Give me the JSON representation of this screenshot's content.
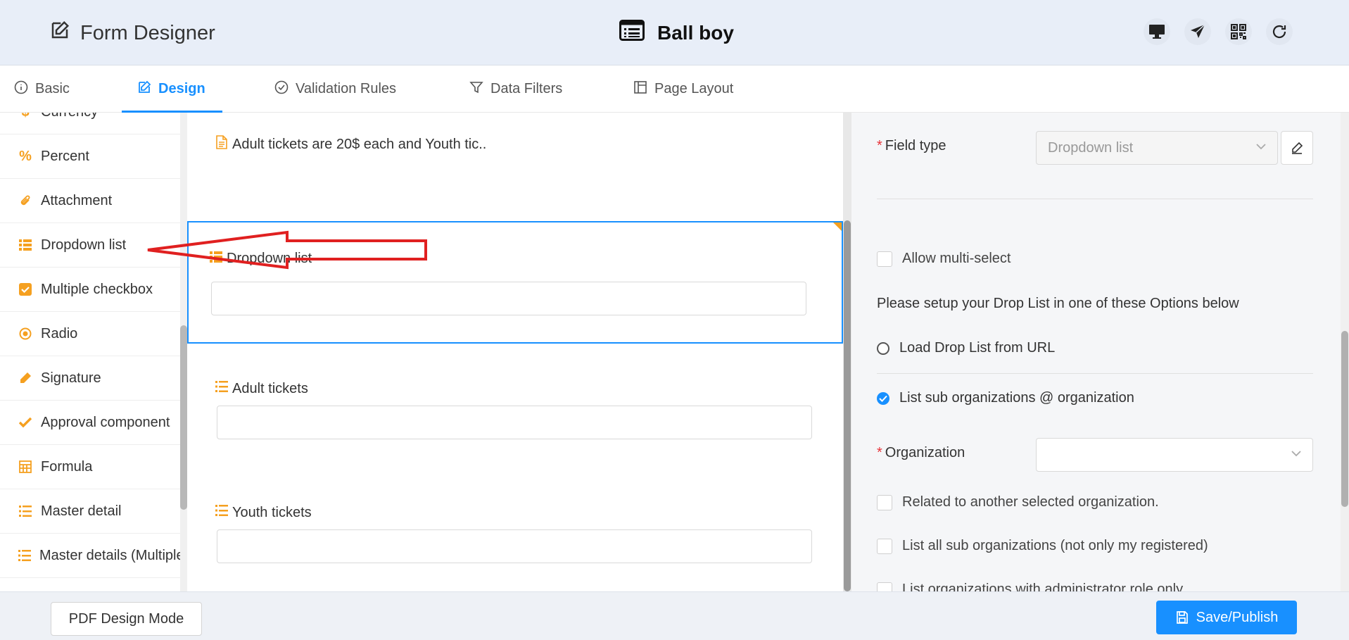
{
  "header": {
    "app_title": "Form Designer",
    "doc_title": "Ball boy",
    "icons": [
      "desktop-icon",
      "send-icon",
      "qrcode-icon",
      "reload-icon"
    ]
  },
  "tabs": [
    {
      "label": "Basic",
      "icon": "info-icon"
    },
    {
      "label": "Design",
      "icon": "edit-icon",
      "active": true
    },
    {
      "label": "Validation Rules",
      "icon": "check-circle-icon"
    },
    {
      "label": "Data Filters",
      "icon": "filter-icon"
    },
    {
      "label": "Page Layout",
      "icon": "layout-icon"
    }
  ],
  "palette": {
    "items": [
      {
        "label": "Currency",
        "icon": "dollar-icon"
      },
      {
        "label": "Percent",
        "icon": "percent-icon"
      },
      {
        "label": "Attachment",
        "icon": "paperclip-icon"
      },
      {
        "label": "Dropdown list",
        "icon": "list-icon"
      },
      {
        "label": "Multiple checkbox",
        "icon": "checkbox-icon"
      },
      {
        "label": "Radio",
        "icon": "radio-icon"
      },
      {
        "label": "Signature",
        "icon": "pencil-icon"
      },
      {
        "label": "Approval component",
        "icon": "checkmark-icon"
      },
      {
        "label": "Formula",
        "icon": "calculator-icon"
      },
      {
        "label": "Master detail",
        "icon": "ordered-list-icon"
      },
      {
        "label": "Master details (Multiple)",
        "icon": "ordered-list-icon"
      }
    ]
  },
  "canvas": {
    "note": "Adult tickets are 20$ each and Youth tic..",
    "fields": [
      {
        "label": "Dropdown list",
        "icon": "list-icon",
        "selected": true
      },
      {
        "label": "Adult tickets",
        "icon": "ordered-list-icon"
      },
      {
        "label": "Youth tickets",
        "icon": "ordered-list-icon"
      }
    ]
  },
  "properties": {
    "field_type_label": "Field type",
    "field_type_value": "Dropdown list",
    "allow_multi_select": "Allow multi-select",
    "setup_text": "Please setup your Drop List in one of these Options below",
    "option_url": "Load Drop List from URL",
    "option_suborg": "List sub organizations @ organization",
    "organization_label": "Organization",
    "organization_value": "",
    "related_org": "Related to another selected organization.",
    "list_all_sub": "List all sub organizations (not only my registered)",
    "admin_only": "List organizations with administrator role only"
  },
  "footer": {
    "pdf_button": "PDF Design Mode",
    "save_button": "Save/Publish"
  },
  "colors": {
    "accent": "#1890ff",
    "palette_icon": "#f5a020",
    "required": "#e8343a",
    "annotation_arrow": "#e02020"
  }
}
